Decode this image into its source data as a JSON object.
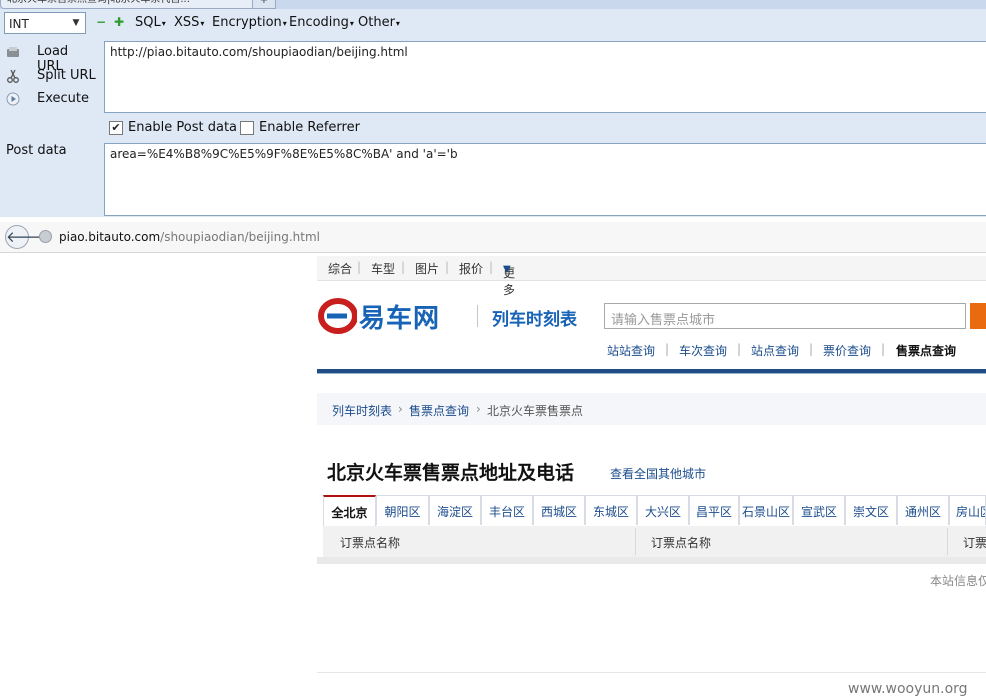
{
  "browser": {
    "tab_title": "北京火车票售票点查询|北京火车票代售...",
    "new_tab": "+"
  },
  "hackbar": {
    "type_select": "INT",
    "menus": [
      "SQL",
      "XSS",
      "Encryption",
      "Encoding",
      "Other"
    ],
    "actions": {
      "load": "Load URL",
      "split": "Split URL",
      "execute": "Execute"
    },
    "url_value": "http://piao.bitauto.com/shoupiaodian/beijing.html",
    "enable_post": "Enable Post data",
    "enable_post_checked": true,
    "enable_referrer": "Enable Referrer",
    "enable_referrer_checked": false,
    "post_label": "Post data",
    "post_value": "area=%E4%B8%9C%E5%9F%8E%E5%8C%BA' and 'a'='b"
  },
  "navbar": {
    "address_host": "piao.bitauto.com",
    "address_path": "/shoupiaodian/beijing.html"
  },
  "page": {
    "top_nav": [
      "综合",
      "车型",
      "图片",
      "报价",
      "更多"
    ],
    "logo_text": "易车网",
    "subtitle": "列车时刻表",
    "search_placeholder": "请输入售票点城市",
    "sub_links": [
      "站站查询",
      "车次查询",
      "站点查询",
      "票价查询",
      "售票点查询"
    ],
    "breadcrumb": [
      "列车时刻表",
      "售票点查询",
      "北京火车票售票点"
    ],
    "heading": "北京火车票售票点地址及电话",
    "other_cities": "查看全国其他城市",
    "district_tabs": [
      "全北京",
      "朝阳区",
      "海淀区",
      "丰台区",
      "西城区",
      "东城区",
      "大兴区",
      "昌平区",
      "石景山区",
      "宣武区",
      "崇文区",
      "通州区",
      "房山区"
    ],
    "table_headers": [
      "订票点名称",
      "订票点名称",
      "订票点名称"
    ],
    "note": "本站信息仅供参考",
    "watermark": "www.wooyun.org"
  },
  "colors": {
    "hackbar_bg": "#dfe9f6",
    "brand_blue": "#1763b6",
    "search_button": "#ea6a10",
    "active_tab_top": "#b01010"
  }
}
